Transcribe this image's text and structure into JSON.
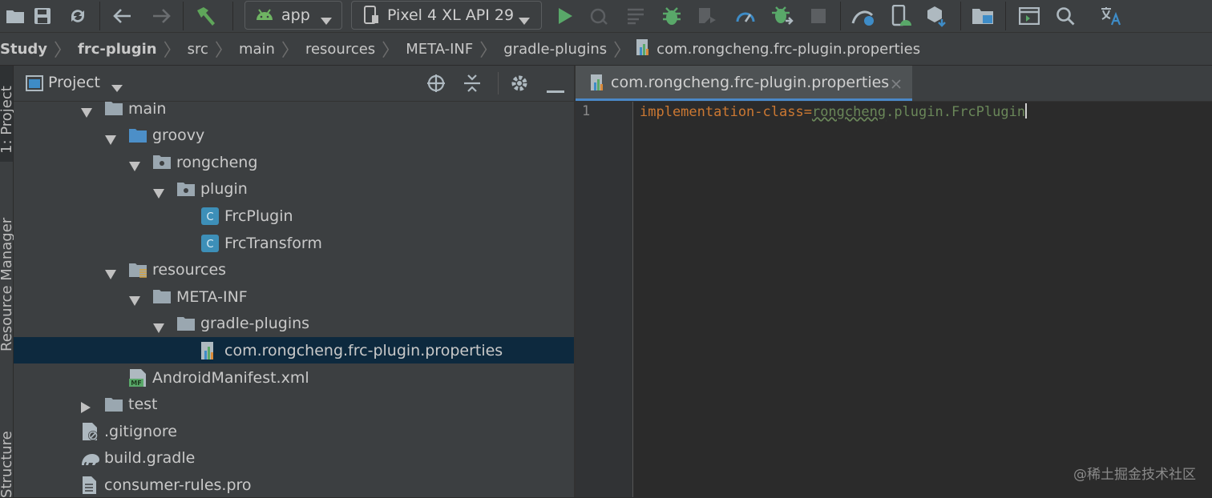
{
  "toolbar": {
    "run_config": "app",
    "device": "Pixel 4 XL API 29",
    "icons": [
      "open-folder-icon",
      "save-icon",
      "sync-icon",
      "back-icon",
      "forward-icon",
      "build-hammer-icon",
      "android-icon",
      "device-icon",
      "run-icon",
      "apply-changes-icon",
      "coverage-icon",
      "debug-icon",
      "profile-icon",
      "profiler-icon",
      "attach-debugger-icon",
      "stop-icon",
      "gradle-sync-icon",
      "avd-manager-icon",
      "sdk-manager-icon",
      "project-structure-icon",
      "terminal-icon",
      "search-icon",
      "translate-icon"
    ]
  },
  "breadcrumbs": [
    "Study",
    "frc-plugin",
    "src",
    "main",
    "resources",
    "META-INF",
    "gradle-plugins",
    "com.rongcheng.frc-plugin.properties"
  ],
  "left_strip": {
    "project_tab": "1: Project",
    "resource_tab": "Resource Manager",
    "structure_tab": "Structure"
  },
  "project_panel": {
    "title": "Project"
  },
  "tree": [
    {
      "label": "main",
      "type": "folder",
      "indent": 0,
      "expanded": true
    },
    {
      "label": "groovy",
      "type": "source-folder",
      "indent": 1,
      "expanded": true
    },
    {
      "label": "rongcheng",
      "type": "package",
      "indent": 2,
      "expanded": true
    },
    {
      "label": "plugin",
      "type": "package",
      "indent": 3,
      "expanded": true
    },
    {
      "label": "FrcPlugin",
      "type": "class",
      "indent": 4
    },
    {
      "label": "FrcTransform",
      "type": "class",
      "indent": 4
    },
    {
      "label": "resources",
      "type": "resources-folder",
      "indent": 1,
      "expanded": true
    },
    {
      "label": "META-INF",
      "type": "folder",
      "indent": 2,
      "expanded": true
    },
    {
      "label": "gradle-plugins",
      "type": "folder",
      "indent": 3,
      "expanded": true
    },
    {
      "label": "com.rongcheng.frc-plugin.properties",
      "type": "properties",
      "indent": 4,
      "selected": true
    },
    {
      "label": "AndroidManifest.xml",
      "type": "manifest",
      "indent": 1
    },
    {
      "label": "test",
      "type": "folder",
      "indent": 0,
      "expanded": false
    },
    {
      "label": ".gitignore",
      "type": "gitignore",
      "indent": -1
    },
    {
      "label": "build.gradle",
      "type": "gradle",
      "indent": -1
    },
    {
      "label": "consumer-rules.pro",
      "type": "file",
      "indent": -1
    }
  ],
  "editor": {
    "tab_label": "com.rongcheng.frc-plugin.properties",
    "line_number": "1",
    "key": "implementation-class",
    "equals": "=",
    "value_part1": "rongcheng",
    "value_part2": ".plugin.FrcPlugin"
  },
  "watermark": "@稀土掘金技术社区",
  "colors": {
    "key": "#cc7832",
    "value": "#6a8759",
    "selection": "#0d293e",
    "tab_underline": "#4a88c7"
  }
}
